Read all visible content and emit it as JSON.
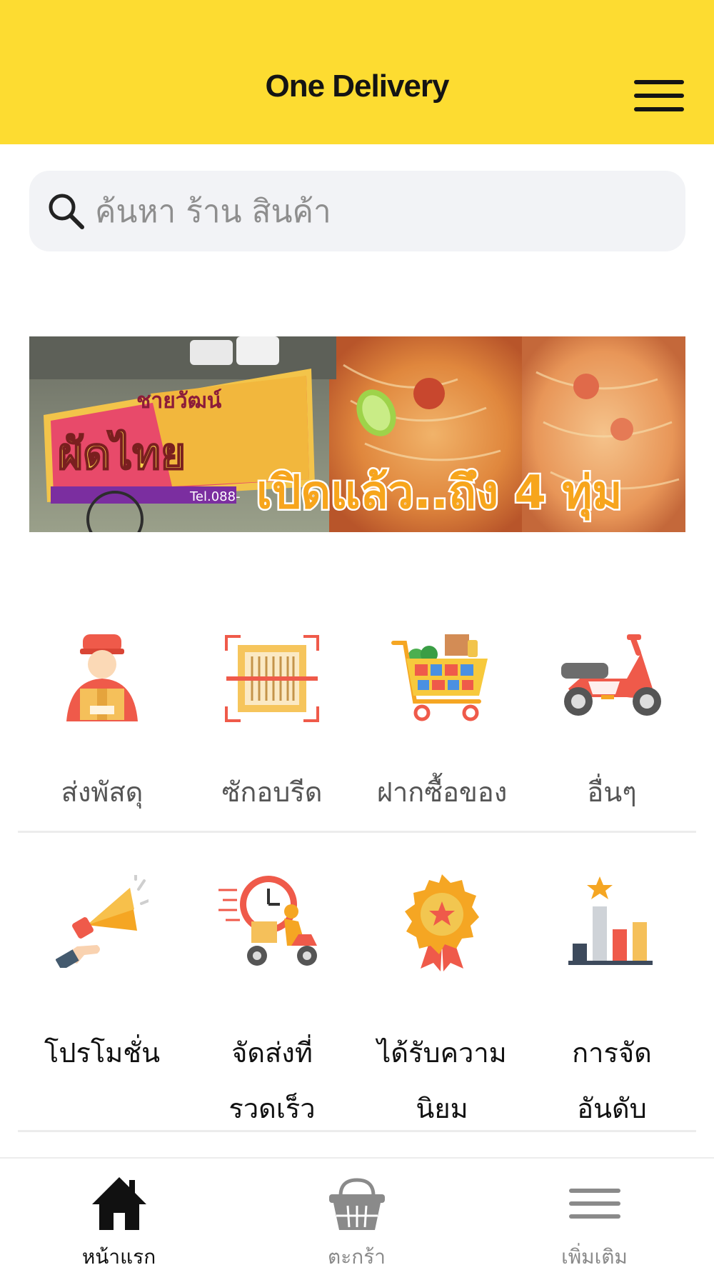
{
  "header": {
    "title": "One Delivery",
    "menu_icon": "hamburger-menu-icon",
    "background": "#fddc31"
  },
  "search": {
    "placeholder": "ค้นหา ร้าน สินค้า",
    "icon": "search-icon"
  },
  "banner": {
    "sign_text": "ผัดไทย",
    "sign_subtext": "ชายวัฒน์",
    "phone_text": "Tel.088-",
    "promo_text": "เปิดแล้ว..ถึง 4 ทุ่ม"
  },
  "categories_row1": [
    {
      "label": "ส่งพัสดุ",
      "icon": "delivery-man-icon"
    },
    {
      "label": "ซักอบรีด",
      "icon": "laundry-scan-icon"
    },
    {
      "label": "ฝากซื้อของ",
      "icon": "shopping-cart-icon"
    },
    {
      "label": "อื่นๆ",
      "icon": "scooter-icon"
    }
  ],
  "categories_row2": [
    {
      "label_line1": "โปรโมชั่น",
      "label_line2": "",
      "icon": "megaphone-icon"
    },
    {
      "label_line1": "จัดส่งที่",
      "label_line2": "รวดเร็ว",
      "icon": "fast-delivery-icon"
    },
    {
      "label_line1": "ได้รับความ",
      "label_line2": "นิยม",
      "icon": "award-badge-icon"
    },
    {
      "label_line1": "การจัด",
      "label_line2": "อันดับ",
      "icon": "ranking-chart-icon"
    }
  ],
  "bottom_nav": [
    {
      "label": "หน้าแรก",
      "icon": "home-icon",
      "active": true
    },
    {
      "label": "ตะกร้า",
      "icon": "basket-icon",
      "active": false
    },
    {
      "label": "เพิ่มเติม",
      "icon": "more-menu-icon",
      "active": false
    }
  ],
  "colors": {
    "active_nav": "#111111",
    "inactive_nav": "#8a8a8a",
    "accent_orange": "#f5a623",
    "accent_red": "#ef5a4a"
  }
}
